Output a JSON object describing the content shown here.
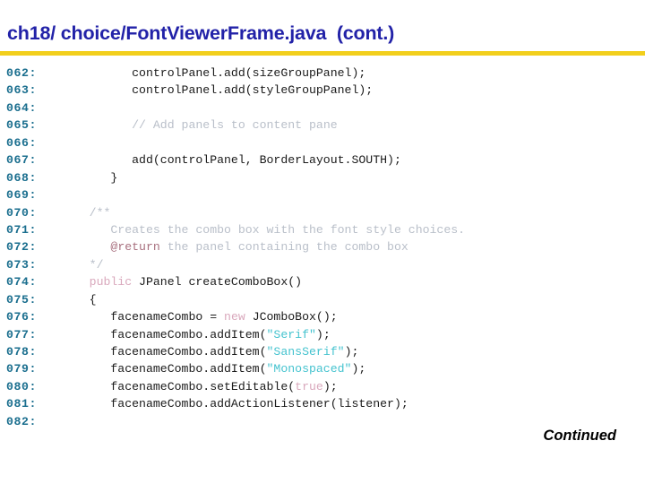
{
  "header": {
    "title": "ch18/ choice/FontViewerFrame.java  (cont.)",
    "rule_color": "#f2cf1c",
    "title_color": "#2222a8"
  },
  "footer": {
    "continued_label": "Continued"
  },
  "theme": {
    "background": "#ffffff",
    "lineno_color": "#1a6e8e",
    "code_color": "#1a1a1a",
    "comment_color": "#b9bfc9",
    "doctag_color": "#a8707f",
    "keyword_color": "#d9a8bc",
    "string_color": "#45c3cf"
  },
  "code_listing": {
    "language": "java",
    "first_line": 62,
    "last_line": 82,
    "lines": [
      {
        "no": "062:",
        "text": "          controlPanel.add(sizeGroupPanel);"
      },
      {
        "no": "063:",
        "text": "          controlPanel.add(styleGroupPanel);"
      },
      {
        "no": "064:",
        "text": ""
      },
      {
        "no": "065:",
        "text": "          // Add panels to content pane"
      },
      {
        "no": "066:",
        "text": ""
      },
      {
        "no": "067:",
        "text": "          add(controlPanel, BorderLayout.SOUTH);"
      },
      {
        "no": "068:",
        "text": "       }"
      },
      {
        "no": "069:",
        "text": ""
      },
      {
        "no": "070:",
        "text": "    /**"
      },
      {
        "no": "071:",
        "text": "       Creates the combo box with the font style choices."
      },
      {
        "no": "072:",
        "text": "       @return the panel containing the combo box"
      },
      {
        "no": "073:",
        "text": "    */"
      },
      {
        "no": "074:",
        "text": "    public JPanel createComboBox()"
      },
      {
        "no": "075:",
        "text": "    {"
      },
      {
        "no": "076:",
        "text": "       facenameCombo = new JComboBox();"
      },
      {
        "no": "077:",
        "text": "       facenameCombo.addItem(\"Serif\");"
      },
      {
        "no": "078:",
        "text": "       facenameCombo.addItem(\"SansSerif\");"
      },
      {
        "no": "079:",
        "text": "       facenameCombo.addItem(\"Monospaced\");"
      },
      {
        "no": "080:",
        "text": "       facenameCombo.setEditable(true);"
      },
      {
        "no": "081:",
        "text": "       facenameCombo.addActionListener(listener);"
      },
      {
        "no": "082:",
        "text": ""
      }
    ],
    "tokens": [
      {
        "line": 0,
        "segments": [
          {
            "t": "          controlPanel.add(sizeGroupPanel);",
            "c": "plain"
          }
        ]
      },
      {
        "line": 1,
        "segments": [
          {
            "t": "          controlPanel.add(styleGroupPanel);",
            "c": "plain"
          }
        ]
      },
      {
        "line": 2,
        "segments": [
          {
            "t": "",
            "c": "plain"
          }
        ]
      },
      {
        "line": 3,
        "segments": [
          {
            "t": "          ",
            "c": "plain"
          },
          {
            "t": "// Add panels to content pane",
            "c": "comment"
          }
        ]
      },
      {
        "line": 4,
        "segments": [
          {
            "t": "",
            "c": "plain"
          }
        ]
      },
      {
        "line": 5,
        "segments": [
          {
            "t": "          add(controlPanel, BorderLayout.SOUTH);",
            "c": "plain"
          }
        ]
      },
      {
        "line": 6,
        "segments": [
          {
            "t": "       }",
            "c": "plain"
          }
        ]
      },
      {
        "line": 7,
        "segments": [
          {
            "t": "",
            "c": "plain"
          }
        ]
      },
      {
        "line": 8,
        "segments": [
          {
            "t": "    ",
            "c": "plain"
          },
          {
            "t": "/**",
            "c": "comment"
          }
        ]
      },
      {
        "line": 9,
        "segments": [
          {
            "t": "    ",
            "c": "plain"
          },
          {
            "t": "   Creates the combo box with the font style choices.",
            "c": "comment"
          }
        ]
      },
      {
        "line": 10,
        "segments": [
          {
            "t": "    ",
            "c": "plain"
          },
          {
            "t": "   ",
            "c": "comment"
          },
          {
            "t": "@return",
            "c": "doctag"
          },
          {
            "t": " the panel containing the combo box",
            "c": "comment"
          }
        ]
      },
      {
        "line": 11,
        "segments": [
          {
            "t": "    ",
            "c": "plain"
          },
          {
            "t": "*/",
            "c": "comment"
          }
        ]
      },
      {
        "line": 12,
        "segments": [
          {
            "t": "    ",
            "c": "plain"
          },
          {
            "t": "public",
            "c": "keyword"
          },
          {
            "t": " JPanel createComboBox()",
            "c": "plain"
          }
        ]
      },
      {
        "line": 13,
        "segments": [
          {
            "t": "    {",
            "c": "plain"
          }
        ]
      },
      {
        "line": 14,
        "segments": [
          {
            "t": "       facenameCombo = ",
            "c": "plain"
          },
          {
            "t": "new",
            "c": "keyword"
          },
          {
            "t": " JComboBox();",
            "c": "plain"
          }
        ]
      },
      {
        "line": 15,
        "segments": [
          {
            "t": "       facenameCombo.addItem(",
            "c": "plain"
          },
          {
            "t": "\"Serif\"",
            "c": "string"
          },
          {
            "t": ");",
            "c": "plain"
          }
        ]
      },
      {
        "line": 16,
        "segments": [
          {
            "t": "       facenameCombo.addItem(",
            "c": "plain"
          },
          {
            "t": "\"SansSerif\"",
            "c": "string"
          },
          {
            "t": ");",
            "c": "plain"
          }
        ]
      },
      {
        "line": 17,
        "segments": [
          {
            "t": "       facenameCombo.addItem(",
            "c": "plain"
          },
          {
            "t": "\"Monospaced\"",
            "c": "string"
          },
          {
            "t": ");",
            "c": "plain"
          }
        ]
      },
      {
        "line": 18,
        "segments": [
          {
            "t": "       facenameCombo.setEditable(",
            "c": "plain"
          },
          {
            "t": "true",
            "c": "keyword"
          },
          {
            "t": ");",
            "c": "plain"
          }
        ]
      },
      {
        "line": 19,
        "segments": [
          {
            "t": "       facenameCombo.addActionListener(listener);",
            "c": "plain"
          }
        ]
      },
      {
        "line": 20,
        "segments": [
          {
            "t": "",
            "c": "plain"
          }
        ]
      }
    ]
  }
}
